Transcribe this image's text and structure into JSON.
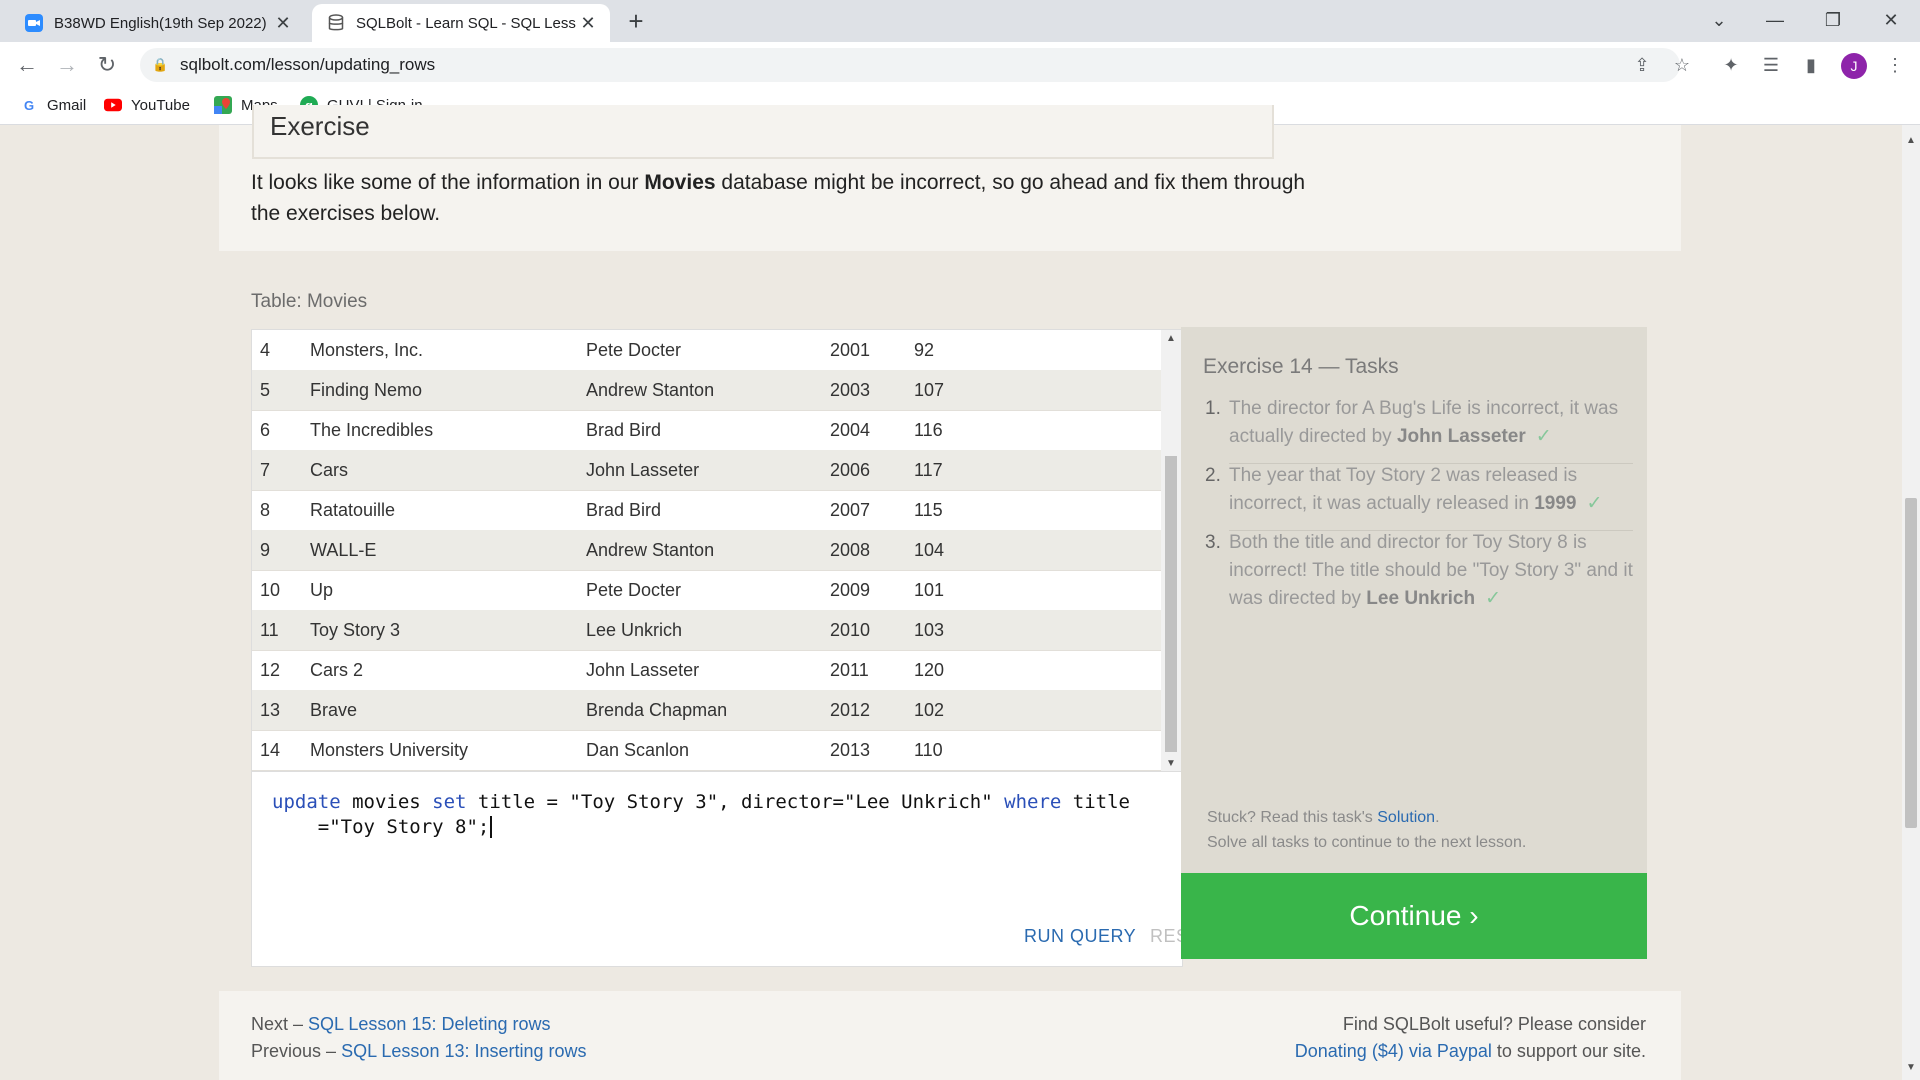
{
  "browser": {
    "tabs": [
      {
        "title": "B38WD English(19th Sep 2022) :",
        "active": false,
        "icon": "zoom-icon"
      },
      {
        "title": "SQLBolt - Learn SQL - SQL Lesso",
        "active": true,
        "icon": "database-icon"
      }
    ],
    "url": "sqlbolt.com/lesson/updating_rows",
    "avatar_letter": "J",
    "bookmarks": [
      {
        "label": "Gmail",
        "icon": "google-icon"
      },
      {
        "label": "YouTube",
        "icon": "youtube-icon"
      },
      {
        "label": "Maps",
        "icon": "maps-icon"
      },
      {
        "label": "GUVI | Sign-in",
        "icon": "guvi-icon"
      }
    ]
  },
  "exercise": {
    "heading": "Exercise",
    "intro_before": "It looks like some of the information in our",
    "intro_bold": "Movies",
    "intro_after": "database might be incorrect, so go ahead and fix them through the exercises below."
  },
  "table": {
    "label": "Table: Movies",
    "rows": [
      [
        "4",
        "Monsters, Inc.",
        "Pete Docter",
        "2001",
        "92"
      ],
      [
        "5",
        "Finding Nemo",
        "Andrew Stanton",
        "2003",
        "107"
      ],
      [
        "6",
        "The Incredibles",
        "Brad Bird",
        "2004",
        "116"
      ],
      [
        "7",
        "Cars",
        "John Lasseter",
        "2006",
        "117"
      ],
      [
        "8",
        "Ratatouille",
        "Brad Bird",
        "2007",
        "115"
      ],
      [
        "9",
        "WALL-E",
        "Andrew Stanton",
        "2008",
        "104"
      ],
      [
        "10",
        "Up",
        "Pete Docter",
        "2009",
        "101"
      ],
      [
        "11",
        "Toy Story 3",
        "Lee Unkrich",
        "2010",
        "103"
      ],
      [
        "12",
        "Cars 2",
        "John Lasseter",
        "2011",
        "120"
      ],
      [
        "13",
        "Brave",
        "Brenda Chapman",
        "2012",
        "102"
      ],
      [
        "14",
        "Monsters University",
        "Dan Scanlon",
        "2013",
        "110"
      ]
    ]
  },
  "editor": {
    "code_line1_kw1": "update",
    "code_line1_a": " movies ",
    "code_line1_kw2": "set",
    "code_line1_b": " title = \"Toy Story 3\", director=\"Lee Unkrich\" ",
    "code_line1_kw3": "where",
    "code_line1_c": " title",
    "code_line2": "    =\"Toy Story 8\";",
    "run_label": "RUN QUERY",
    "reset_label": "RESET"
  },
  "tasks": {
    "heading": "Exercise 14 — Tasks",
    "items": [
      {
        "num": "1.",
        "text": "The director for A Bug's Life is incorrect, it was actually directed by",
        "bold": "John Lasseter",
        "check": "✓"
      },
      {
        "num": "2.",
        "text": "The year that Toy Story 2 was released is incorrect, it was actually released in",
        "bold": "1999",
        "check": "✓"
      },
      {
        "num": "3.",
        "text": "Both the title and director for Toy Story 8 is incorrect! The title should be \"Toy Story 3\" and it was directed by",
        "bold": "Lee Unkrich",
        "check": "✓"
      }
    ],
    "stuck_text": "Stuck? Read this task's",
    "solution_link": "Solution",
    "solve_all": "Solve all tasks to continue to the next lesson.",
    "continue_label": "Continue ›"
  },
  "footer": {
    "next_prefix": "Next –",
    "next_link": "SQL Lesson 15: Deleting rows",
    "prev_prefix": "Previous –",
    "prev_link": "SQL Lesson 13: Inserting rows",
    "right_line1": "Find SQLBolt useful? Please consider",
    "donate_link": "Donating ($4) via Paypal",
    "right_line2_suffix": "to support our site."
  },
  "colors": {
    "accent_green": "#39b54a",
    "link_blue": "#2a6ab0",
    "keyword_blue": "#2a4fb8"
  }
}
